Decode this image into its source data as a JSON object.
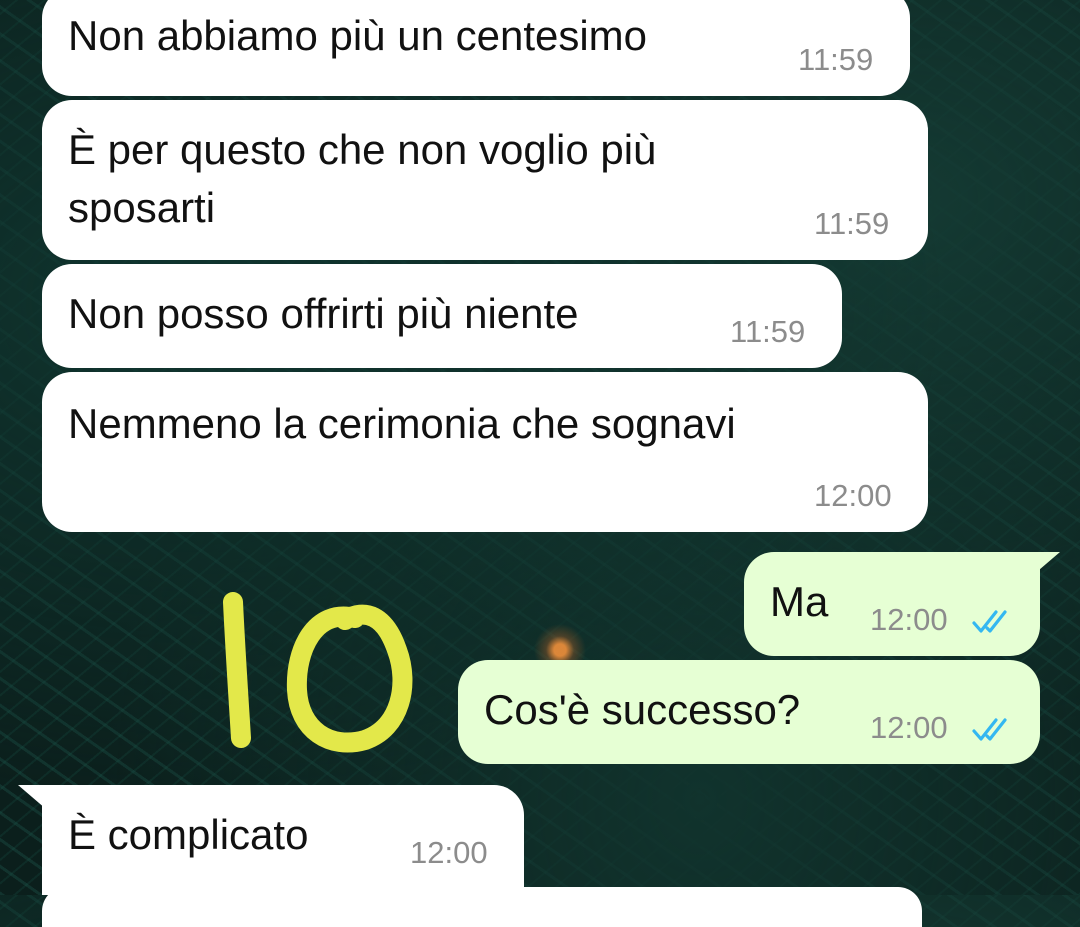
{
  "messages": [
    {
      "direction": "in",
      "text": "Non abbiamo più un centesimo",
      "time": "11:59"
    },
    {
      "direction": "in",
      "text": "È per questo che non voglio più sposarti",
      "text_line1": "È per questo che non voglio più",
      "text_line2": "sposarti",
      "time": "11:59"
    },
    {
      "direction": "in",
      "text": "Non posso offrirti più niente",
      "time": "11:59"
    },
    {
      "direction": "in",
      "text": "Nemmeno la cerimonia che sognavi",
      "time": "12:00"
    },
    {
      "direction": "out",
      "text": "Ma",
      "time": "12:00",
      "status": "read"
    },
    {
      "direction": "out",
      "text": "Cos'è successo?",
      "time": "12:00",
      "status": "read"
    },
    {
      "direction": "in",
      "text": "È complicato",
      "time": "12:00"
    }
  ],
  "annotation": {
    "text": "10",
    "color": "#e3e84a"
  },
  "colors": {
    "incoming_bubble": "#ffffff",
    "outgoing_bubble": "#e6ffd4",
    "read_ticks": "#34b7f1",
    "timestamp": "#8c8c8c"
  },
  "icons": {
    "read_receipt": "double-check-icon"
  }
}
